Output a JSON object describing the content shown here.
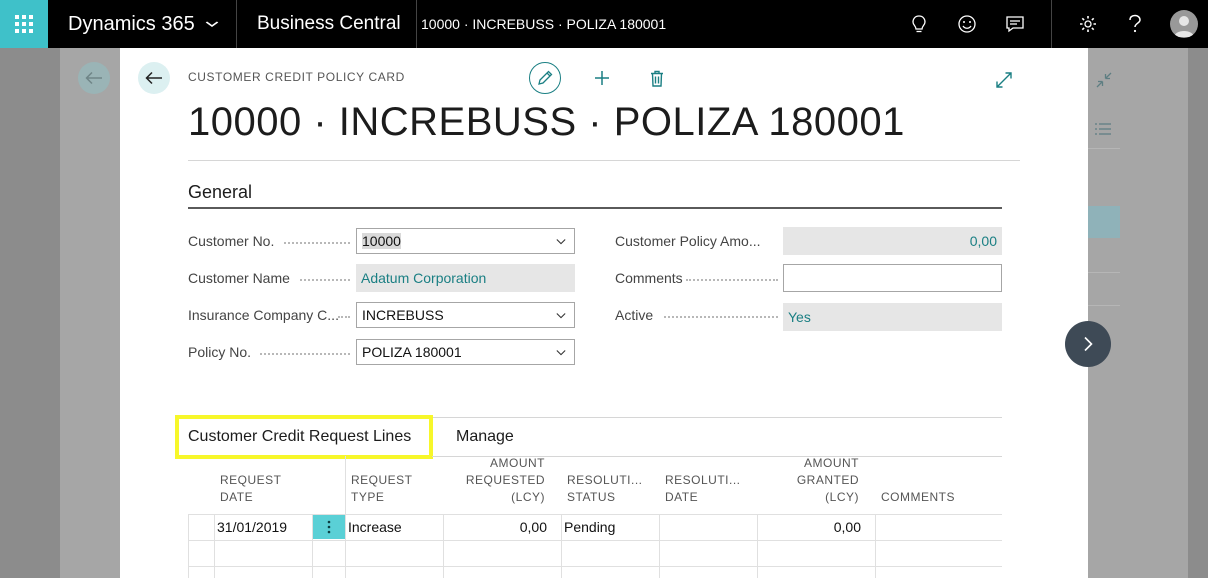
{
  "topbar": {
    "product": "Dynamics 365",
    "app": "Business Central",
    "breadcrumb": "10000 · INCREBUSS · POLIZA 180001",
    "icons": [
      "waffle-icon",
      "lightbulb-icon",
      "smiley-icon",
      "chat-icon",
      "gear-icon",
      "help-icon",
      "user-avatar-icon"
    ]
  },
  "card": {
    "caption": "CUSTOMER CREDIT POLICY CARD",
    "title": "10000 · INCREBUSS · POLIZA 180001",
    "actions": [
      "edit-icon",
      "new-icon",
      "delete-icon",
      "expand-icon"
    ]
  },
  "general": {
    "title": "General",
    "customer_no": {
      "label": "Customer No.",
      "value": "10000"
    },
    "customer_name": {
      "label": "Customer Name",
      "value": "Adatum Corporation"
    },
    "insurance_company": {
      "label": "Insurance Company C...",
      "value": "INCREBUSS"
    },
    "policy_no": {
      "label": "Policy No.",
      "value": "POLIZA 180001"
    },
    "customer_policy_amount": {
      "label": "Customer Policy Amo...",
      "value": "0,00"
    },
    "comments": {
      "label": "Comments",
      "value": ""
    },
    "active": {
      "label": "Active",
      "value": "Yes"
    }
  },
  "lines": {
    "tab_label": "Customer Credit Request Lines",
    "manage_label": "Manage",
    "headers": {
      "request_date": [
        "REQUEST",
        "DATE"
      ],
      "request_type": [
        "REQUEST",
        "TYPE"
      ],
      "amount_requested": [
        "AMOUNT",
        "REQUESTED",
        "(LCY)"
      ],
      "resolution_status": [
        "RESOLUTI...",
        "STATUS"
      ],
      "resolution_date": [
        "RESOLUTI...",
        "DATE"
      ],
      "amount_granted": [
        "AMOUNT",
        "GRANTED",
        "(LCY)"
      ],
      "comments": [
        "COMMENTS"
      ]
    },
    "rows": [
      {
        "request_date": "31/01/2019",
        "request_type": "Increase",
        "amount_requested": "0,00",
        "resolution_status": "Pending",
        "resolution_date": "",
        "amount_granted": "0,00",
        "comments": ""
      }
    ]
  },
  "colors": {
    "accent": "#3fc1c9",
    "link": "#1a7f83",
    "highlight": "#f7f72a"
  }
}
